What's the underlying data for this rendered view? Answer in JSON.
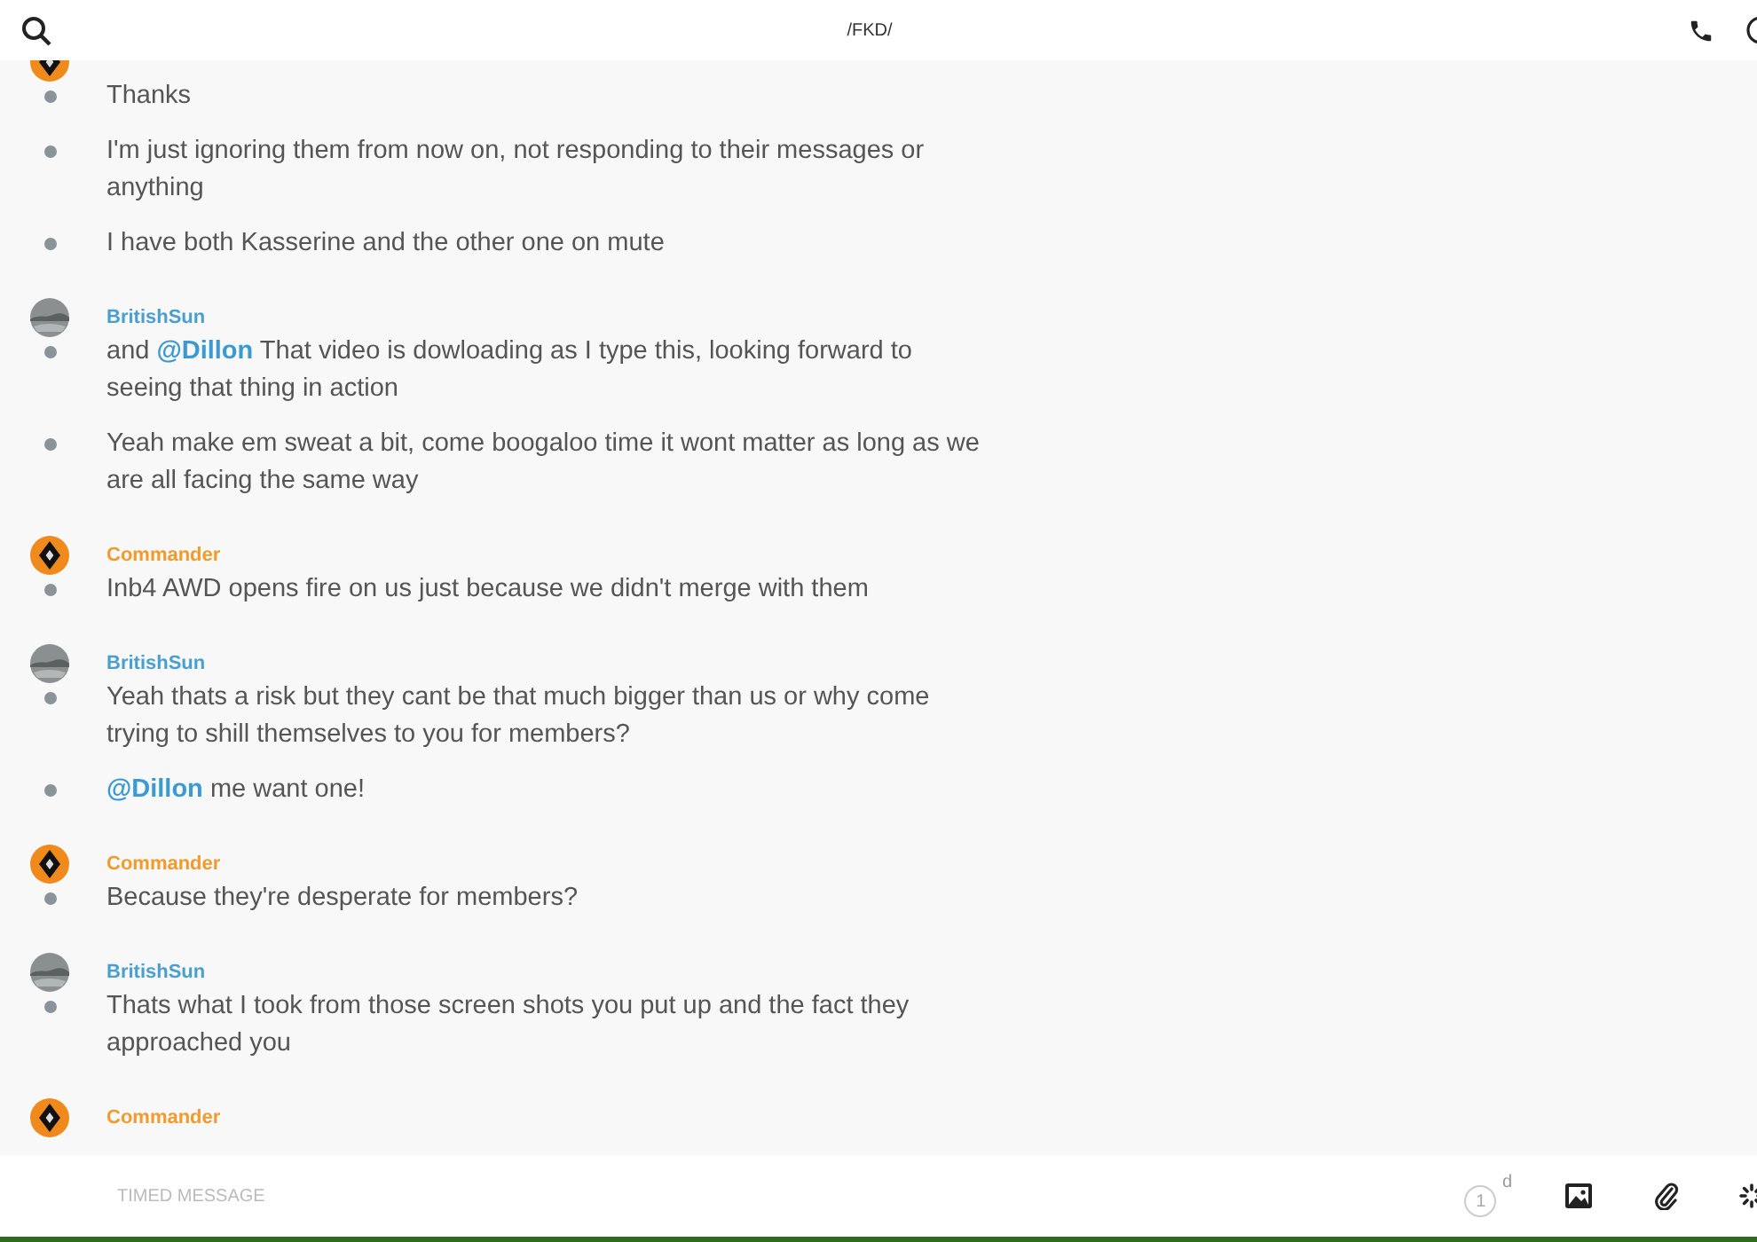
{
  "header": {
    "title": "/FKD/"
  },
  "groups": [
    {
      "kind": "emblem",
      "messages": [
        "Thanks",
        "I'm just ignoring them from now on, not responding to their messages or anything",
        "I have both Kasserine and the other one on mute"
      ]
    },
    {
      "sender": "BritishSun",
      "color": "#4a9fd1",
      "kind": "photo",
      "messages": [
        "and **@Dillon** That video is dowloading as I type this, looking forward to seeing that thing in action",
        "Yeah make em sweat a bit, come boogaloo time it wont matter as long as we are all facing the same way"
      ]
    },
    {
      "sender": "Commander",
      "color": "#f39a2c",
      "kind": "emblem",
      "messages": [
        "Inb4 AWD opens fire on us just because we didn't merge with them"
      ]
    },
    {
      "sender": "BritishSun",
      "color": "#4a9fd1",
      "kind": "photo",
      "messages": [
        "Yeah thats a risk but they cant be that much bigger than us or why come trying to shill themselves to you for members?",
        "**@Dillon** me want one!"
      ]
    },
    {
      "sender": "Commander",
      "color": "#f39a2c",
      "kind": "emblem",
      "messages": [
        "Because they're desperate for members?"
      ]
    },
    {
      "sender": "BritishSun",
      "color": "#4a9fd1",
      "kind": "photo",
      "messages": [
        "Thats what I took from those screen shots you put up and the fact they approached you"
      ]
    },
    {
      "sender": "Commander",
      "color": "#f39a2c",
      "kind": "emblem"
    }
  ],
  "composer": {
    "placeholder": "TIMED MESSAGE",
    "timer": {
      "value": "1",
      "unit": "d"
    }
  }
}
